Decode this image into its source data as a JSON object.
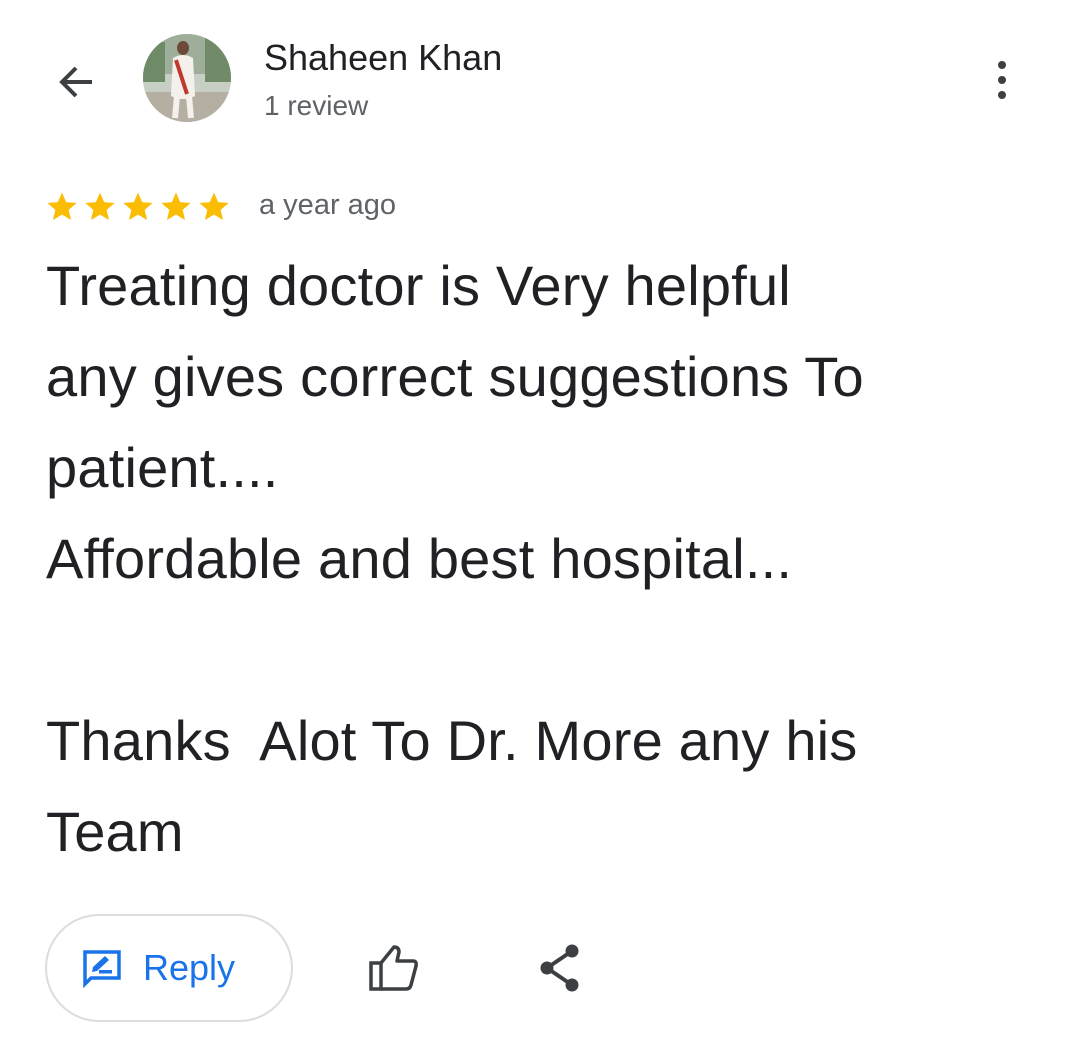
{
  "header": {
    "back_icon": "arrow-left-icon",
    "more_icon": "more-vertical-icon"
  },
  "reviewer": {
    "name": "Shaheen Khan",
    "review_count": "1 review"
  },
  "review": {
    "rating": 5,
    "max_rating": 5,
    "star_color": "#fbbc04",
    "time": "a year ago",
    "text": "Treating doctor is Very helpful\nany gives correct suggestions To\npatient....\nAffordable and best hospital...\n\nThanks  Alot To Dr. More any his\nTeam"
  },
  "actions": {
    "reply_label": "Reply",
    "reply_icon": "rate-review-icon",
    "like_icon": "thumb-up-outline-icon",
    "share_icon": "share-icon",
    "accent_color": "#1a73e8"
  }
}
